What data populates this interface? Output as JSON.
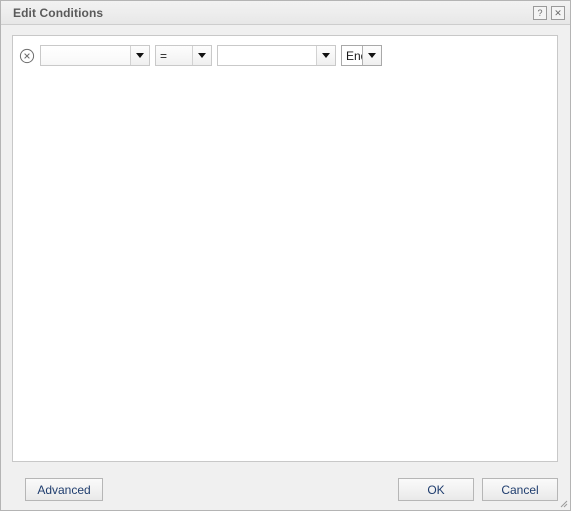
{
  "window": {
    "title": "Edit Conditions",
    "help_button": "?",
    "close_button": "✕"
  },
  "conditions": {
    "rows": [
      {
        "remove_icon": "circle-x-icon",
        "field": {
          "value": "",
          "placeholder": ""
        },
        "operator": {
          "value": "=",
          "placeholder": ""
        },
        "value": {
          "value": "",
          "placeholder": ""
        },
        "conjunction": {
          "value": "End",
          "placeholder": ""
        }
      }
    ]
  },
  "footer": {
    "advanced_label": "Advanced",
    "ok_label": "OK",
    "cancel_label": "Cancel"
  },
  "colors": {
    "dialog_background": "#f0f0f0",
    "panel_background": "#ffffff",
    "titlebar_background": "#ededed",
    "title_text": "#5a5a5a",
    "button_text": "#1f3d6e",
    "border": "#c8c8c8"
  }
}
